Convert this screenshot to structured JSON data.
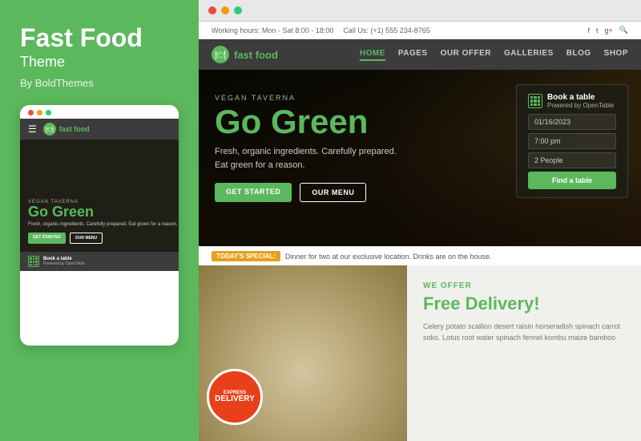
{
  "left": {
    "title": "Fast Food",
    "subtitle": "Theme",
    "author": "By BoldThemes",
    "mobile": {
      "nav": {
        "logo_text": "fast food"
      },
      "hero": {
        "tag": "VEGAN TAVERNA",
        "heading": "Go Green",
        "subtext": "Fresh, organic ingredients.\nCarefully prepared.\nEat green for a reason.",
        "btn_start": "GET STARTED",
        "btn_menu": "OUR MENU"
      },
      "book_bar": {
        "title": "Book a table",
        "subtitle": "Powered by OpenTable"
      }
    }
  },
  "right": {
    "browser": {
      "dots": [
        "red",
        "yellow",
        "green"
      ]
    },
    "topbar": {
      "working_hours": "Working hours: Mon - Sat 8:00 - 18:00",
      "call_us": "Call Us: (+1) 555 234-8765",
      "social": [
        "f",
        "t",
        "g+",
        "Q"
      ]
    },
    "nav": {
      "logo_text": "fast food",
      "links": [
        {
          "label": "HOME",
          "active": true
        },
        {
          "label": "PAGES",
          "active": false
        },
        {
          "label": "OUR OFFER",
          "active": false
        },
        {
          "label": "GALLERIES",
          "active": false
        },
        {
          "label": "BLOG",
          "active": false
        },
        {
          "label": "SHOP",
          "active": false
        }
      ]
    },
    "hero": {
      "tag": "VEGAN TAVERNA",
      "heading": "Go Green",
      "subline1": "Fresh, organic ingredients. Carefully prepared.",
      "subline2": "Eat green for a reason.",
      "btn_start": "GET STARTED",
      "btn_menu": "OUR MENU"
    },
    "book_table": {
      "title": "Book a table",
      "subtitle": "Powered by OpenTable",
      "date": "01/16/2023",
      "time": "7:00 pm",
      "guests": "2 People",
      "btn_label": "Find a table"
    },
    "todays_special": {
      "label": "TODAY'S SPECIAL:",
      "text": "Dinner for two at our exclusive location. Drinks are on the house."
    },
    "bottom": {
      "we_offer": "WE OFFER",
      "heading_free": "Free",
      "heading_rest": " Delivery!",
      "description": "Celery potato scallion desert raisin horseradish spinach carrot soko. Lotus root water spinach fennel kombu maize bamboo",
      "express_top": "EXPRESS",
      "express_main": "DELIVERY"
    }
  }
}
